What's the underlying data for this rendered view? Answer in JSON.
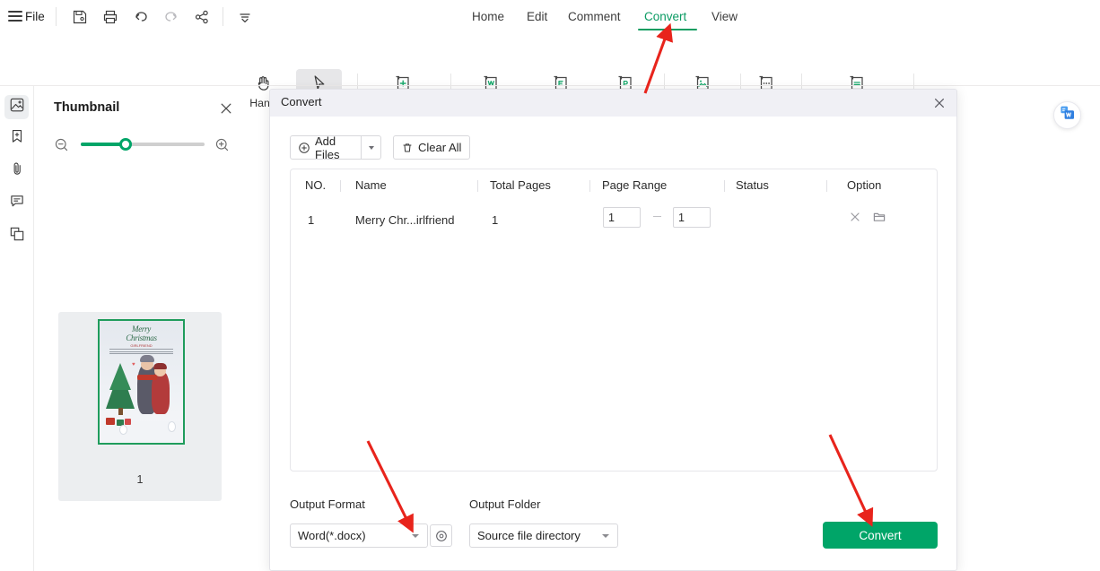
{
  "topbar": {
    "menu_icon": "hamburger-icon",
    "file_label": "File",
    "quick_tools": [
      {
        "name": "save-icon",
        "label": "Save"
      },
      {
        "name": "print-icon",
        "label": "Print"
      },
      {
        "name": "undo-icon",
        "label": "Undo"
      },
      {
        "name": "redo-icon",
        "label": "Redo"
      },
      {
        "name": "share-icon",
        "label": "Share"
      },
      {
        "name": "more-options-icon",
        "label": "More"
      }
    ]
  },
  "tabs": {
    "items": [
      {
        "label": "Home",
        "active": false
      },
      {
        "label": "Edit",
        "active": false
      },
      {
        "label": "Comment",
        "active": false
      },
      {
        "label": "Convert",
        "active": true
      },
      {
        "label": "View",
        "active": false
      }
    ],
    "active_color": "#0f9d61"
  },
  "ribbon": {
    "buttons": [
      {
        "label": "Hand",
        "icon": "hand-icon",
        "selected": false
      },
      {
        "label": "Select",
        "icon": "cursor-arrow-icon",
        "selected": true
      },
      {
        "label": "Create PDF",
        "icon": "create-pdf-icon",
        "selected": false
      },
      {
        "label": "To Word",
        "icon": "to-word-icon",
        "selected": false
      },
      {
        "label": "To Excel",
        "icon": "to-excel-icon",
        "selected": false
      },
      {
        "label": "To PPT",
        "icon": "to-ppt-icon",
        "selected": false
      },
      {
        "label": "To Image",
        "icon": "to-image-icon",
        "selected": false
      },
      {
        "label": "More",
        "icon": "more-icon",
        "selected": false
      },
      {
        "label": "Batch Convert",
        "icon": "batch-convert-icon",
        "selected": false
      }
    ]
  },
  "rail": {
    "items": [
      {
        "name": "thumbnail-icon",
        "label": "Thumbnail",
        "active": true
      },
      {
        "name": "bookmark-icon",
        "label": "Bookmark",
        "active": false
      },
      {
        "name": "attachment-icon",
        "label": "Attachment",
        "active": false
      },
      {
        "name": "comment-icon",
        "label": "Comment",
        "active": false
      },
      {
        "name": "layers-icon",
        "label": "Layers",
        "active": false
      }
    ]
  },
  "thumbnail_panel": {
    "title": "Thumbnail",
    "close_icon": "close-icon",
    "zoom_out_icon": "zoom-out-icon",
    "zoom_in_icon": "zoom-in-icon",
    "slider_value": 30,
    "page_number": "1",
    "page_art": {
      "title_line1": "Merry",
      "title_line2": "Christmas",
      "subtitle": "GIRLFRIEND"
    }
  },
  "dialog": {
    "title": "Convert",
    "close_icon": "close-icon",
    "toolbar": {
      "add_files_label": "Add Files",
      "add_files_icon": "plus-circle-icon",
      "add_files_caret": "chevron-down-icon",
      "clear_all_label": "Clear All",
      "clear_all_icon": "trash-icon"
    },
    "table": {
      "headers": [
        "NO.",
        "Name",
        "Total Pages",
        "Page Range",
        "Status",
        "Option"
      ],
      "rows": [
        {
          "no": "1",
          "name": "Merry Chr...irlfriend",
          "total_pages": "1",
          "page_range_from": "1",
          "page_range_to": "1",
          "status": "",
          "option_remove_icon": "close-icon",
          "option_folder_icon": "folder-icon"
        }
      ]
    },
    "output_format": {
      "label": "Output Format",
      "value": "Word(*.docx)",
      "caret": "chevron-down-icon"
    },
    "settings_button": {
      "icon": "gear-icon",
      "label": "Settings"
    },
    "output_folder": {
      "label": "Output Folder",
      "value": "Source file directory",
      "caret": "chevron-down-icon"
    },
    "convert_button": {
      "label": "Convert",
      "color": "#00a568"
    }
  },
  "float_badge": {
    "icon": "pdf-to-word-icon",
    "label": "PDF to Word"
  },
  "annotations": {
    "color": "#e8241c",
    "arrows": [
      {
        "name": "arrow-to-convert-tab",
        "target": "Convert tab"
      },
      {
        "name": "arrow-to-output-format",
        "target": "Output Format dropdown"
      },
      {
        "name": "arrow-to-convert-button",
        "target": "Convert button"
      }
    ]
  }
}
